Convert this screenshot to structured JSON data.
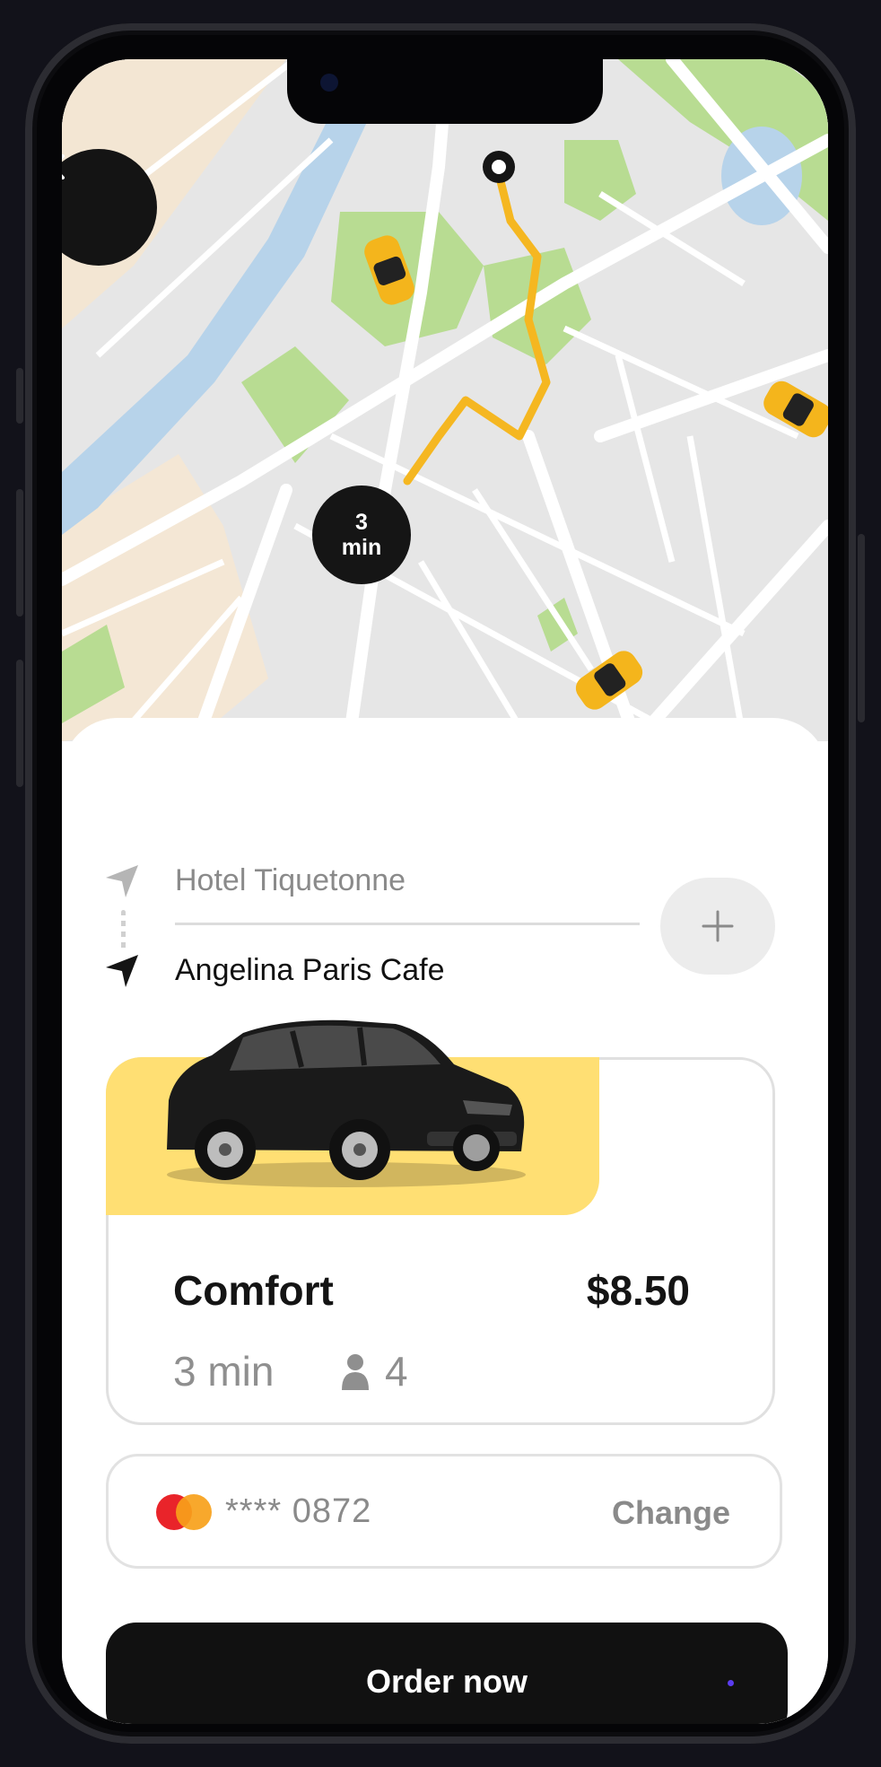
{
  "map": {
    "eta_value": "3",
    "eta_unit": "min"
  },
  "route": {
    "from": "Hotel Tiquetonne",
    "to": "Angelina Paris Cafe"
  },
  "ride": {
    "name": "Comfort",
    "price": "$8.50",
    "eta": "3 min",
    "seats": "4"
  },
  "payment": {
    "card_number": "**** 0872",
    "change_label": "Change"
  },
  "order_label": "Order now",
  "colors": {
    "accent_yellow": "#ffdf73",
    "route_orange": "#f5b721",
    "dark": "#111111"
  }
}
